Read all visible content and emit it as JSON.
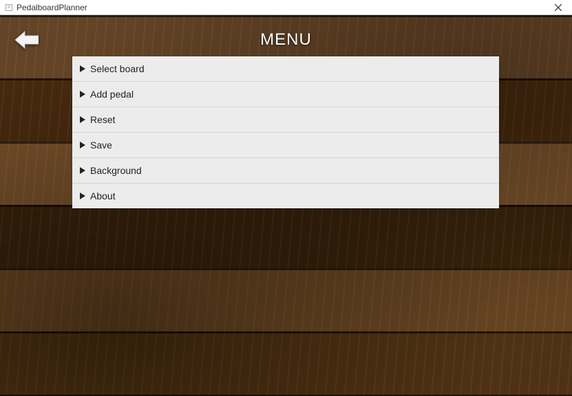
{
  "window": {
    "title": "PedalboardPlanner"
  },
  "header": {
    "menu_label": "MENU"
  },
  "menu": {
    "items": [
      {
        "label": "Select board",
        "name": "menu-item-select-board"
      },
      {
        "label": "Add pedal",
        "name": "menu-item-add-pedal"
      },
      {
        "label": "Reset",
        "name": "menu-item-reset"
      },
      {
        "label": "Save",
        "name": "menu-item-save"
      },
      {
        "label": "Background",
        "name": "menu-item-background"
      },
      {
        "label": "About",
        "name": "menu-item-about"
      }
    ]
  }
}
